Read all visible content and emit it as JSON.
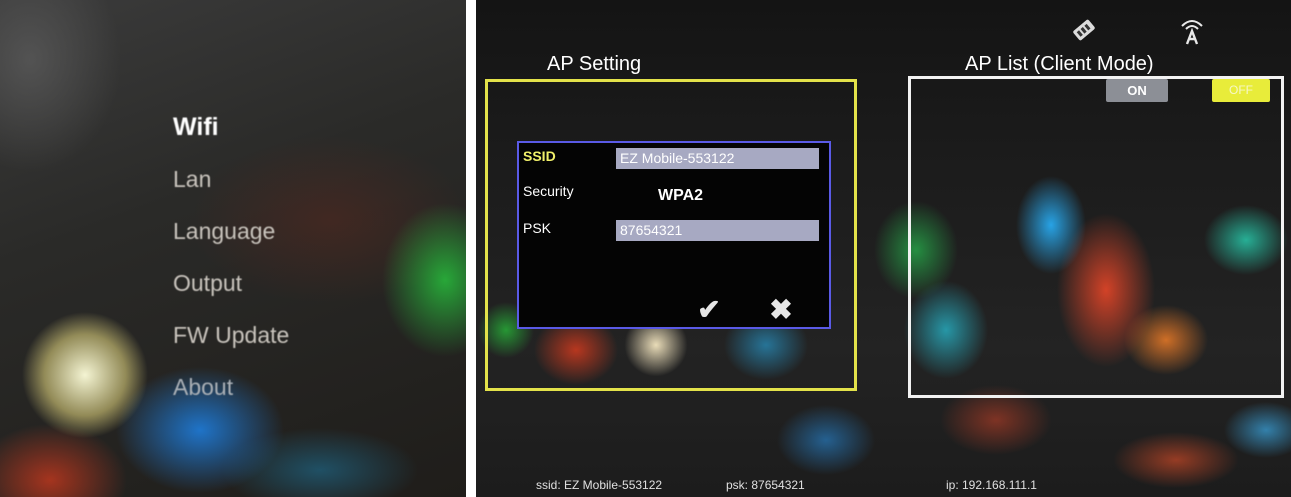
{
  "settings_menu": {
    "items": [
      {
        "label": "Wifi"
      },
      {
        "label": "Lan"
      },
      {
        "label": "Language"
      },
      {
        "label": "Output"
      },
      {
        "label": "FW Update"
      },
      {
        "label": "About"
      }
    ],
    "selected": "Wifi"
  },
  "top_icons": {
    "first": "settings-tag-icon",
    "second": "wifi-ap-icon"
  },
  "ap_setting": {
    "title": "AP Setting",
    "ssid_label": "SSID",
    "ssid_value": "EZ Mobile-553122",
    "security_label": "Security",
    "security_value": "WPA2",
    "psk_label": "PSK",
    "psk_value": "87654321",
    "confirm_glyph": "✔",
    "cancel_glyph": "✖"
  },
  "ap_list": {
    "title": "AP List (Client Mode)",
    "on_label": "ON",
    "off_label": "OFF",
    "selected": "OFF"
  },
  "status_bar": {
    "ssid_text": "ssid: EZ Mobile-553122",
    "psk_text": "psk: 87654321",
    "ip_text": "ip: 192.168.111.1"
  },
  "colors": {
    "selection_yellow": "#e3e24a",
    "form_border_blue": "#5a5ae6",
    "field_fill": "#a7a9c2"
  }
}
